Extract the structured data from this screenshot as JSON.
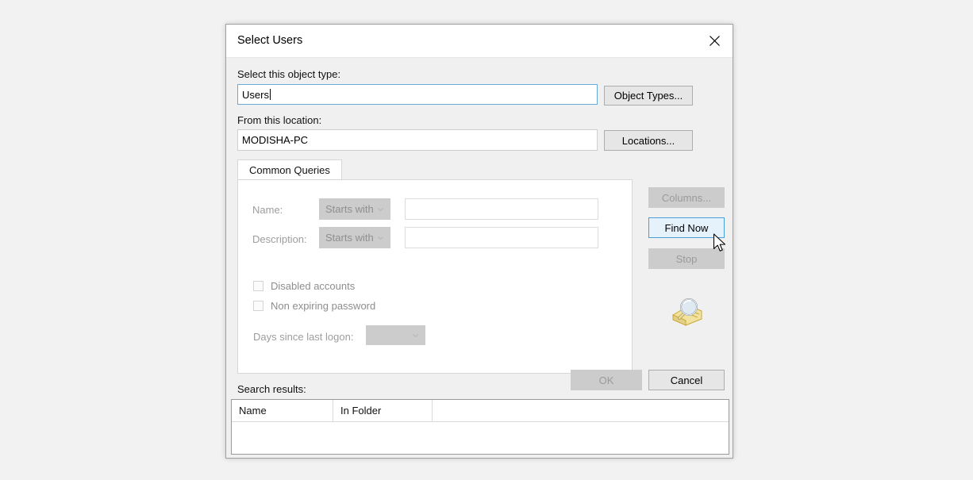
{
  "dialog": {
    "title": "Select Users",
    "close_icon": "close-icon"
  },
  "object_type": {
    "label": "Select this object type:",
    "value": "Users",
    "button_label": "Object Types..."
  },
  "location": {
    "label": "From this location:",
    "value": "MODISHA-PC",
    "button_label": "Locations..."
  },
  "tabs": [
    {
      "label": "Common Queries",
      "selected": true
    }
  ],
  "query": {
    "name": {
      "label": "Name:",
      "operator": "Starts with",
      "value": "",
      "placeholder": ""
    },
    "description": {
      "label": "Description:",
      "operator": "Starts with",
      "value": "",
      "placeholder": ""
    },
    "disabled_accounts": {
      "label": "Disabled accounts",
      "checked": false
    },
    "non_expiring_password": {
      "label": "Non expiring password",
      "checked": false
    },
    "days_since_last_logon": {
      "label": "Days since last logon:",
      "value": ""
    }
  },
  "side_buttons": {
    "columns_label": "Columns...",
    "find_now_label": "Find Now",
    "stop_label": "Stop"
  },
  "icons": {
    "search_icon": "search-magnifier-icon"
  },
  "footer": {
    "search_results_label": "Search results:",
    "ok_label": "OK",
    "cancel_label": "Cancel"
  },
  "results": {
    "columns": [
      "Name",
      "In Folder"
    ],
    "rows": []
  },
  "colors": {
    "accent_blue": "#4a9fd8",
    "hover_fill": "#e5f1fb",
    "dialog_bg": "#f0f0f0",
    "page_bg": "#f2f2f2",
    "disabled_text": "#9a9a9a"
  }
}
